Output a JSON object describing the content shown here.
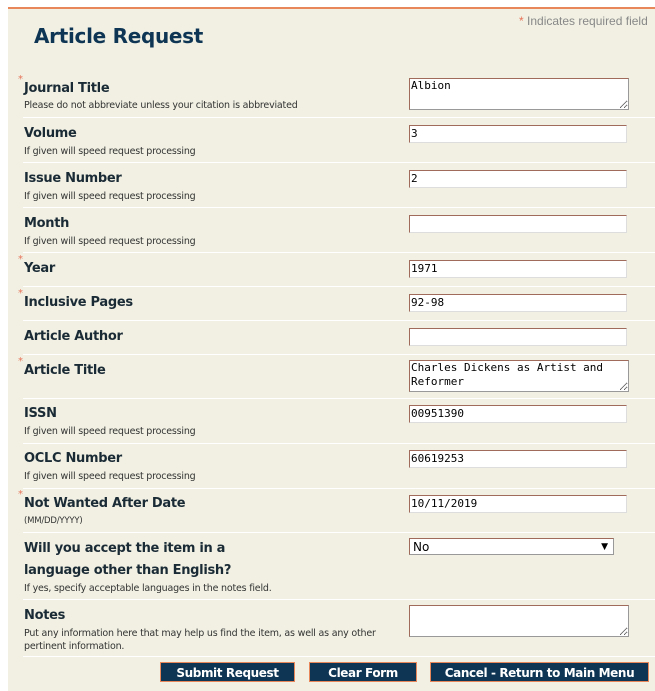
{
  "required_note": {
    "star": "*",
    "text": "Indicates required field"
  },
  "title": "Article Request",
  "fields": [
    {
      "label": "Journal Title",
      "hint": "Please do not abbreviate unless your citation is abbreviated",
      "value": "Albion",
      "required": true
    },
    {
      "label": "Volume",
      "hint": "If given will speed request processing",
      "value": "3"
    },
    {
      "label": "Issue Number",
      "hint": "If given will speed request processing",
      "value": "2"
    },
    {
      "label": "Month",
      "hint": "If given will speed request processing",
      "value": ""
    },
    {
      "label": "Year",
      "value": "1971",
      "required": true
    },
    {
      "label": "Inclusive Pages",
      "value": "92-98",
      "required": true
    },
    {
      "label": "Article Author",
      "value": ""
    },
    {
      "label": "Article Title",
      "value": "Charles Dickens as Artist and Reformer",
      "required": true
    },
    {
      "label": "ISSN",
      "hint": "If given will speed request processing",
      "value": "00951390"
    },
    {
      "label": "OCLC Number",
      "hint": "If given will speed request processing",
      "value": "60619253"
    },
    {
      "label": "Not Wanted After Date",
      "hint": "(MM/DD/YYYY)",
      "value": "10/11/2019",
      "required": true
    },
    {
      "label_line1": "Will you accept the item in a",
      "label_line2": "language other than English?",
      "hint": "If yes, specify acceptable languages in the notes field.",
      "value": "No"
    },
    {
      "label": "Notes",
      "hint_line1": "Put any information here that may help us find the item, as well as any other",
      "hint_line2": "pertinent information.",
      "value": ""
    }
  ],
  "required_star": "*",
  "select_arrow": "▼",
  "buttons": {
    "submit": "Submit Request",
    "clear": "Clear Form",
    "cancel": "Cancel - Return to Main Menu"
  }
}
